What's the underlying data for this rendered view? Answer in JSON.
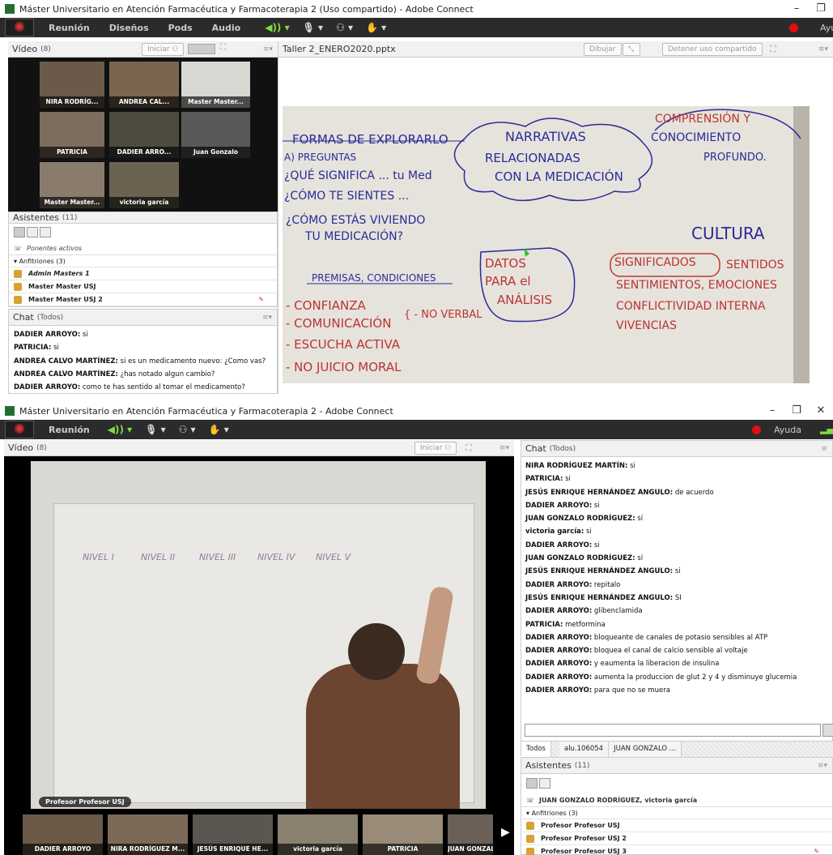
{
  "top_window": {
    "title": "Máster Universitario en Atención Farmacéutica y Farmacoterapia 2 (Uso compartido) - Adobe Connect",
    "menu": [
      "Reunión",
      "Diseños",
      "Pods",
      "Audio"
    ],
    "help_label": "Ayu",
    "video_pod": {
      "title": "Vídeo",
      "count": "(8)",
      "start_button": "Iniciar",
      "tiles": [
        "NIRA RODRÍG...",
        "ANDREA CAL...",
        "Master Master...",
        "PATRICIA",
        "DADIER ARRO...",
        "Juan Gonzalo",
        "Master Master...",
        "victoria garcía"
      ]
    },
    "share_pod": {
      "title": "Taller 2_ENERO2020.pptx",
      "draw_button": "Dibujar",
      "stop_button": "Detener uso compartido"
    },
    "attendees_pod": {
      "title": "Asistentes",
      "count": "(11)",
      "active_speakers": "Ponentes activos",
      "hosts_header": "Anfitriones (3)",
      "hosts": [
        "Admin Masters 1",
        "Master Master USJ",
        "Master Master USJ 2"
      ]
    },
    "chat_pod": {
      "title": "Chat",
      "scope": "(Todos)",
      "messages": [
        {
          "author": "DADIER ARROYO:",
          "text": " si"
        },
        {
          "author": "PATRICIA:",
          "text": " si"
        },
        {
          "author": "ANDREA CALVO MARTÍNEZ:",
          "text": " si es un medicamento nuevo: ¿Como vas?"
        },
        {
          "author": "ANDREA CALVO MARTÍNEZ:",
          "text": " ¿has notado algun cambio?"
        },
        {
          "author": "DADIER ARROYO:",
          "text": " como te has sentido al tomar el medicamento?"
        }
      ]
    },
    "whiteboard": {
      "l1": "FORMAS DE EXPLORARLO",
      "l2": "A) PREGUNTAS",
      "l3": "¿QUÉ SIGNIFICA ... tu Med",
      "l4": "¿CÓMO TE SIENTES ...",
      "l5": "¿CÓMO ESTÁS VIVIENDO",
      "l6": "TU MEDICACIÓN?",
      "l7": "PREMISAS, CONDICIONES",
      "l8": "- CONFIANZA",
      "l9": "- COMUNICACIÓN",
      "l10": "- ESCUCHA ACTIVA",
      "l11": "- NO JUICIO MORAL",
      "l12": "{ - NO VERBAL",
      "c1": "NARRATIVAS",
      "c2": "RELACIONADAS",
      "c3": "CON LA MEDICACIÓN",
      "d1": "DATOS",
      "d2": "PARA el",
      "d3": "ANÁLISIS",
      "r1": "COMPRENSIÓN Y",
      "r2": "CONOCIMIENTO",
      "r3": "PROFUNDO.",
      "r4": "CULTURA",
      "r5": "SIGNIFICADOS",
      "r6": "SENTIDOS",
      "r7": "SENTIMIENTOS, EMOCIONES",
      "r8": "CONFLICTIVIDAD INTERNA",
      "r9": "VIVENCIAS"
    }
  },
  "bottom_window": {
    "title": "Máster Universitario en Atención Farmacéutica y Farmacoterapia 2 - Adobe Connect",
    "menu": [
      "Reunión"
    ],
    "help_label": "Ayuda",
    "video_pod": {
      "title": "Vídeo",
      "count": "(8)",
      "start_button": "Iniciar",
      "main_label": "Profesor Profesor USJ",
      "board_columns": [
        "NIVEL I",
        "NIVEL II",
        "NIVEL III",
        "NIVEL IV",
        "NIVEL V"
      ],
      "thumbs": [
        "DADIER ARROYO",
        "NIRA RODRÍGUEZ M...",
        "JESÚS ENRIQUE HE...",
        "victoria garcía",
        "PATRICIA",
        "JUAN GONZAL..."
      ]
    },
    "chat_pod": {
      "title": "Chat",
      "scope": "(Todos)",
      "messages": [
        {
          "author": "NIRA RODRÍGUEZ MARTÍN:",
          "text": " si"
        },
        {
          "author": "PATRICIA:",
          "text": " si"
        },
        {
          "author": "JESÚS ENRIQUE HERNÁNDEZ ANGULO:",
          "text": " de acuerdo"
        },
        {
          "author": "DADIER ARROYO:",
          "text": " si"
        },
        {
          "author": "JUAN GONZALO RODRÍGUEZ:",
          "text": " sí"
        },
        {
          "author": "victoria garcía:",
          "text": " si"
        },
        {
          "author": "DADIER ARROYO:",
          "text": " si"
        },
        {
          "author": "JUAN GONZALO RODRÍGUEZ:",
          "text": " sí"
        },
        {
          "author": "JESÚS ENRIQUE HERNÁNDEZ ANGULO:",
          "text": " si"
        },
        {
          "author": "DADIER ARROYO:",
          "text": " repitalo"
        },
        {
          "author": "JESÚS ENRIQUE HERNÁNDEZ ANGULO:",
          "text": " SI"
        },
        {
          "author": "DADIER ARROYO:",
          "text": " glibenclamida"
        },
        {
          "author": "PATRICIA:",
          "text": " metformina"
        },
        {
          "author": "DADIER ARROYO:",
          "text": " bloqueante de canales de potasio sensibles al ATP"
        },
        {
          "author": "DADIER ARROYO:",
          "text": " bloquea el canal de calcio sensible al voltaje"
        },
        {
          "author": "DADIER ARROYO:",
          "text": " y eaumenta la liberacion de insulina"
        },
        {
          "author": "DADIER ARROYO:",
          "text": " aumenta la produccion de glut 2 y  4 y disminuye glucemia"
        },
        {
          "author": "DADIER ARROYO:",
          "text": " para que no se muera"
        }
      ],
      "tabs": [
        "Todos",
        "alu.106054",
        "JUAN GONZALO ..."
      ]
    },
    "attendees_pod": {
      "title": "Asistentes",
      "count": "(11)",
      "active_speakers": "JUAN GONZALO RODRÍGUEZ, victoria garcía",
      "hosts_header": "Anfitriones (3)",
      "hosts": [
        "Profesor Profesor USJ",
        "Profesor Profesor USJ 2",
        "Profesor Profesor USJ 3"
      ]
    }
  },
  "colors": {
    "menubar": "#2b2b2b",
    "record": "#e01010",
    "marker_blue": "#2a2a9a",
    "marker_red": "#c0392b"
  }
}
